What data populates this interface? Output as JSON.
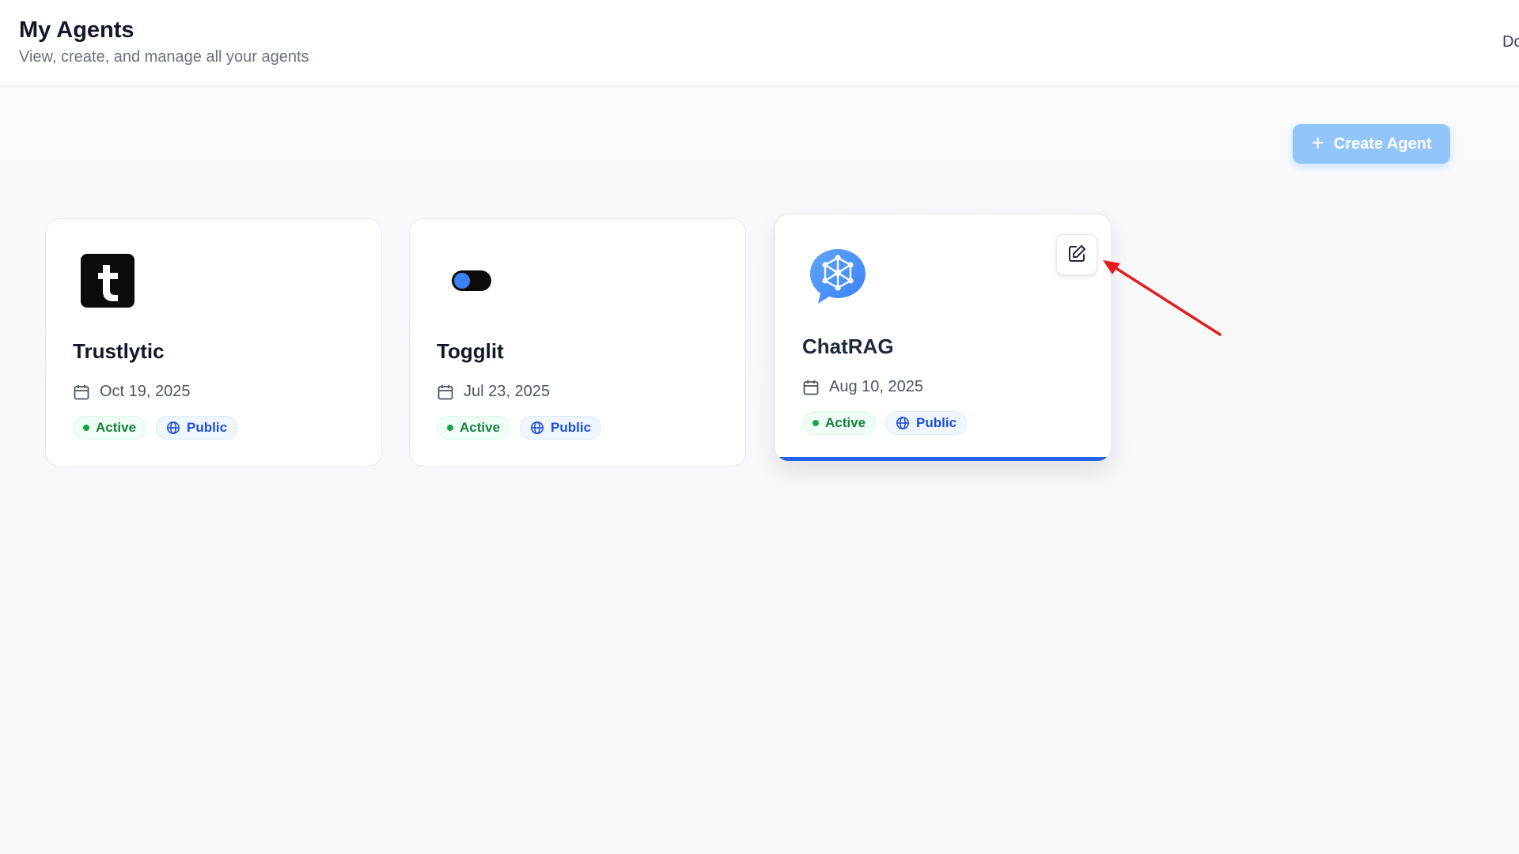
{
  "header": {
    "title": "My Agents",
    "subtitle": "View, create, and manage all your agents",
    "right_text": "Do"
  },
  "toolbar": {
    "create_label": "Create Agent",
    "create_icon": "plus-icon"
  },
  "agents": [
    {
      "name": "Trustlytic",
      "date": "Oct 19, 2025",
      "status": "Active",
      "visibility": "Public",
      "logo": "trustlytic-logo-icon"
    },
    {
      "name": "Togglit",
      "date": "Jul 23, 2025",
      "status": "Active",
      "visibility": "Public",
      "logo": "toggle-logo-icon"
    },
    {
      "name": "ChatRAG",
      "date": "Aug 10, 2025",
      "status": "Active",
      "visibility": "Public",
      "logo": "chat-network-logo-icon",
      "selected": true
    }
  ],
  "colors": {
    "primary": "#2563eb",
    "create_button": "#93c5fd",
    "active_green": "#15803d",
    "public_blue": "#1d4ed8",
    "annotation_arrow": "#e11d1d"
  }
}
